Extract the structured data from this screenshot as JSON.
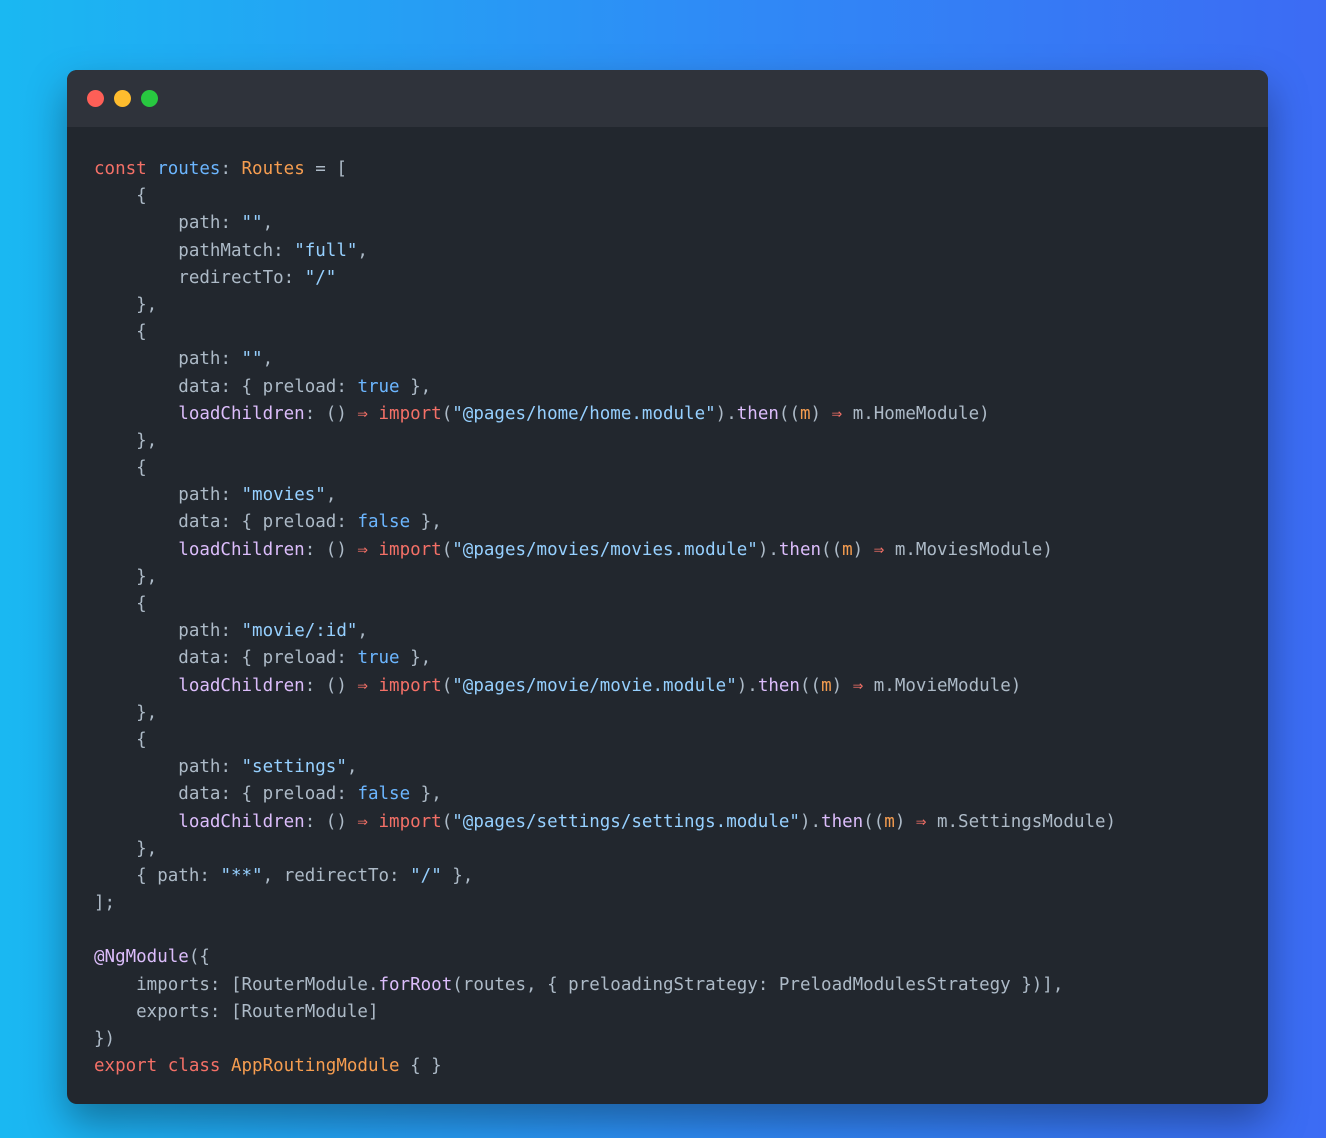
{
  "window": {
    "controls": [
      "close",
      "minimize",
      "maximize"
    ]
  },
  "colors": {
    "keyword": "#f47067",
    "variable": "#6cb6ff",
    "type": "#f69d50",
    "string": "#96d0ff",
    "function": "#dcbdfb",
    "text": "#adbac7",
    "background": "#22272e",
    "titlebar": "#2f333b"
  },
  "code": {
    "lines": [
      [
        [
          "kw",
          "const "
        ],
        [
          "var",
          "routes"
        ],
        [
          "plain",
          ": "
        ],
        [
          "type",
          "Routes"
        ],
        [
          "plain",
          " = ["
        ]
      ],
      [
        [
          "plain",
          "    {"
        ]
      ],
      [
        [
          "prop",
          "        path"
        ],
        [
          "plain",
          ": "
        ],
        [
          "str",
          "\"\""
        ],
        [
          "plain",
          ","
        ]
      ],
      [
        [
          "prop",
          "        pathMatch"
        ],
        [
          "plain",
          ": "
        ],
        [
          "str",
          "\"full\""
        ],
        [
          "plain",
          ","
        ]
      ],
      [
        [
          "prop",
          "        redirectTo"
        ],
        [
          "plain",
          ": "
        ],
        [
          "str",
          "\"/\""
        ]
      ],
      [
        [
          "plain",
          "    },"
        ]
      ],
      [
        [
          "plain",
          "    {"
        ]
      ],
      [
        [
          "prop",
          "        path"
        ],
        [
          "plain",
          ": "
        ],
        [
          "str",
          "\"\""
        ],
        [
          "plain",
          ","
        ]
      ],
      [
        [
          "prop",
          "        data"
        ],
        [
          "plain",
          ": { "
        ],
        [
          "prop",
          "preload"
        ],
        [
          "plain",
          ": "
        ],
        [
          "bool",
          "true"
        ],
        [
          "plain",
          " },"
        ]
      ],
      [
        [
          "fn",
          "        loadChildren"
        ],
        [
          "plain",
          ": () "
        ],
        [
          "kw",
          "⇒"
        ],
        [
          "plain",
          " "
        ],
        [
          "kw",
          "import"
        ],
        [
          "plain",
          "("
        ],
        [
          "str",
          "\"@pages/home/home.module\""
        ],
        [
          "plain",
          ")."
        ],
        [
          "fn",
          "then"
        ],
        [
          "plain",
          "(("
        ],
        [
          "param",
          "m"
        ],
        [
          "plain",
          ") "
        ],
        [
          "kw",
          "⇒"
        ],
        [
          "plain",
          " m.HomeModule)"
        ]
      ],
      [
        [
          "plain",
          "    },"
        ]
      ],
      [
        [
          "plain",
          "    {"
        ]
      ],
      [
        [
          "prop",
          "        path"
        ],
        [
          "plain",
          ": "
        ],
        [
          "str",
          "\"movies\""
        ],
        [
          "plain",
          ","
        ]
      ],
      [
        [
          "prop",
          "        data"
        ],
        [
          "plain",
          ": { "
        ],
        [
          "prop",
          "preload"
        ],
        [
          "plain",
          ": "
        ],
        [
          "bool",
          "false"
        ],
        [
          "plain",
          " },"
        ]
      ],
      [
        [
          "fn",
          "        loadChildren"
        ],
        [
          "plain",
          ": () "
        ],
        [
          "kw",
          "⇒"
        ],
        [
          "plain",
          " "
        ],
        [
          "kw",
          "import"
        ],
        [
          "plain",
          "("
        ],
        [
          "str",
          "\"@pages/movies/movies.module\""
        ],
        [
          "plain",
          ")."
        ],
        [
          "fn",
          "then"
        ],
        [
          "plain",
          "(("
        ],
        [
          "param",
          "m"
        ],
        [
          "plain",
          ") "
        ],
        [
          "kw",
          "⇒"
        ],
        [
          "plain",
          " m.MoviesModule)"
        ]
      ],
      [
        [
          "plain",
          "    },"
        ]
      ],
      [
        [
          "plain",
          "    {"
        ]
      ],
      [
        [
          "prop",
          "        path"
        ],
        [
          "plain",
          ": "
        ],
        [
          "str",
          "\"movie/:id\""
        ],
        [
          "plain",
          ","
        ]
      ],
      [
        [
          "prop",
          "        data"
        ],
        [
          "plain",
          ": { "
        ],
        [
          "prop",
          "preload"
        ],
        [
          "plain",
          ": "
        ],
        [
          "bool",
          "true"
        ],
        [
          "plain",
          " },"
        ]
      ],
      [
        [
          "fn",
          "        loadChildren"
        ],
        [
          "plain",
          ": () "
        ],
        [
          "kw",
          "⇒"
        ],
        [
          "plain",
          " "
        ],
        [
          "kw",
          "import"
        ],
        [
          "plain",
          "("
        ],
        [
          "str",
          "\"@pages/movie/movie.module\""
        ],
        [
          "plain",
          ")."
        ],
        [
          "fn",
          "then"
        ],
        [
          "plain",
          "(("
        ],
        [
          "param",
          "m"
        ],
        [
          "plain",
          ") "
        ],
        [
          "kw",
          "⇒"
        ],
        [
          "plain",
          " m.MovieModule)"
        ]
      ],
      [
        [
          "plain",
          "    },"
        ]
      ],
      [
        [
          "plain",
          "    {"
        ]
      ],
      [
        [
          "prop",
          "        path"
        ],
        [
          "plain",
          ": "
        ],
        [
          "str",
          "\"settings\""
        ],
        [
          "plain",
          ","
        ]
      ],
      [
        [
          "prop",
          "        data"
        ],
        [
          "plain",
          ": { "
        ],
        [
          "prop",
          "preload"
        ],
        [
          "plain",
          ": "
        ],
        [
          "bool",
          "false"
        ],
        [
          "plain",
          " },"
        ]
      ],
      [
        [
          "fn",
          "        loadChildren"
        ],
        [
          "plain",
          ": () "
        ],
        [
          "kw",
          "⇒"
        ],
        [
          "plain",
          " "
        ],
        [
          "kw",
          "import"
        ],
        [
          "plain",
          "("
        ],
        [
          "str",
          "\"@pages/settings/settings.module\""
        ],
        [
          "plain",
          ")."
        ],
        [
          "fn",
          "then"
        ],
        [
          "plain",
          "(("
        ],
        [
          "param",
          "m"
        ],
        [
          "plain",
          ") "
        ],
        [
          "kw",
          "⇒"
        ],
        [
          "plain",
          " m.SettingsModule)"
        ]
      ],
      [
        [
          "plain",
          "    },"
        ]
      ],
      [
        [
          "plain",
          "    { "
        ],
        [
          "prop",
          "path"
        ],
        [
          "plain",
          ": "
        ],
        [
          "str",
          "\"**\""
        ],
        [
          "plain",
          ", "
        ],
        [
          "prop",
          "redirectTo"
        ],
        [
          "plain",
          ": "
        ],
        [
          "str",
          "\"/\""
        ],
        [
          "plain",
          " },"
        ]
      ],
      [
        [
          "plain",
          "];"
        ]
      ],
      [
        [
          "plain",
          ""
        ]
      ],
      [
        [
          "fn",
          "@NgModule"
        ],
        [
          "plain",
          "({"
        ]
      ],
      [
        [
          "prop",
          "    imports"
        ],
        [
          "plain",
          ": [RouterModule."
        ],
        [
          "fn",
          "forRoot"
        ],
        [
          "plain",
          "(routes, { "
        ],
        [
          "prop",
          "preloadingStrategy"
        ],
        [
          "plain",
          ": PreloadModulesStrategy })],"
        ]
      ],
      [
        [
          "prop",
          "    exports"
        ],
        [
          "plain",
          ": [RouterModule]"
        ]
      ],
      [
        [
          "plain",
          "})"
        ]
      ],
      [
        [
          "kw",
          "export "
        ],
        [
          "kw",
          "class "
        ],
        [
          "type",
          "AppRoutingModule"
        ],
        [
          "plain",
          " { }"
        ]
      ]
    ]
  }
}
